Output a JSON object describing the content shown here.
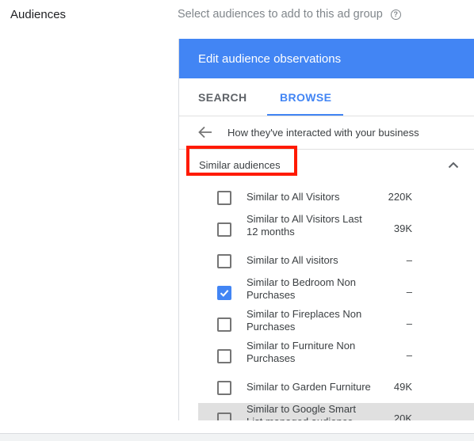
{
  "section": {
    "label": "Audiences",
    "hint": "Select audiences to add to this ad group",
    "help_icon": "help-circle-icon"
  },
  "panel": {
    "title": "Edit audience observations",
    "tabs": [
      {
        "label": "SEARCH",
        "active": false
      },
      {
        "label": "BROWSE",
        "active": true
      }
    ],
    "breadcrumb": "How they've interacted with your business",
    "category": {
      "label": "Similar audiences",
      "expanded": true,
      "highlight_color": "#ff1a00"
    },
    "items": [
      {
        "name": "Similar to All Visitors",
        "size": "220K",
        "checked": false
      },
      {
        "name": "Similar to All Visitors Last 12 months",
        "size": "39K",
        "checked": false
      },
      {
        "name": "Similar to All visitors",
        "size": "–",
        "checked": false
      },
      {
        "name": "Similar to Bedroom Non Purchases",
        "size": "–",
        "checked": true
      },
      {
        "name": "Similar to Fireplaces Non Purchases",
        "size": "–",
        "checked": false
      },
      {
        "name": "Similar to Furniture Non Purchases",
        "size": "–",
        "checked": false
      },
      {
        "name": "Similar to Garden Furniture",
        "size": "49K",
        "checked": false
      },
      {
        "name": "Similar to Google Smart List managed audience",
        "size": "20K",
        "checked": false
      }
    ]
  },
  "colors": {
    "accent": "#4285f4",
    "highlight": "#ff1a00"
  }
}
